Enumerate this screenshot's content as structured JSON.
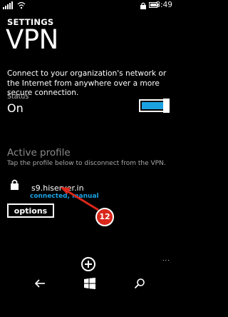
{
  "status_bar": {
    "time": "8:49"
  },
  "header": {
    "app_title": "SETTINGS",
    "page_title": "VPN"
  },
  "description": "Connect to your organization's network or the Internet from anywhere over a more secure connection.",
  "vpn_toggle": {
    "label": "Status",
    "value": "On",
    "on": true
  },
  "active_profile": {
    "heading": "Active profile",
    "hint": "Tap the profile below to disconnect from the VPN.",
    "profile": {
      "name": "s9.hiserver.in",
      "status": "connected, manual"
    }
  },
  "options_button": {
    "label": "options"
  },
  "annotation": {
    "number": "12",
    "color": "#d9271b"
  },
  "app_bar": {
    "add_icon": "plus-circle-icon",
    "more": "..."
  },
  "nav_bar": {
    "back": "back-arrow-icon",
    "start": "windows-logo-icon",
    "search": "search-icon"
  },
  "colors": {
    "accent": "#1ba1e2"
  }
}
